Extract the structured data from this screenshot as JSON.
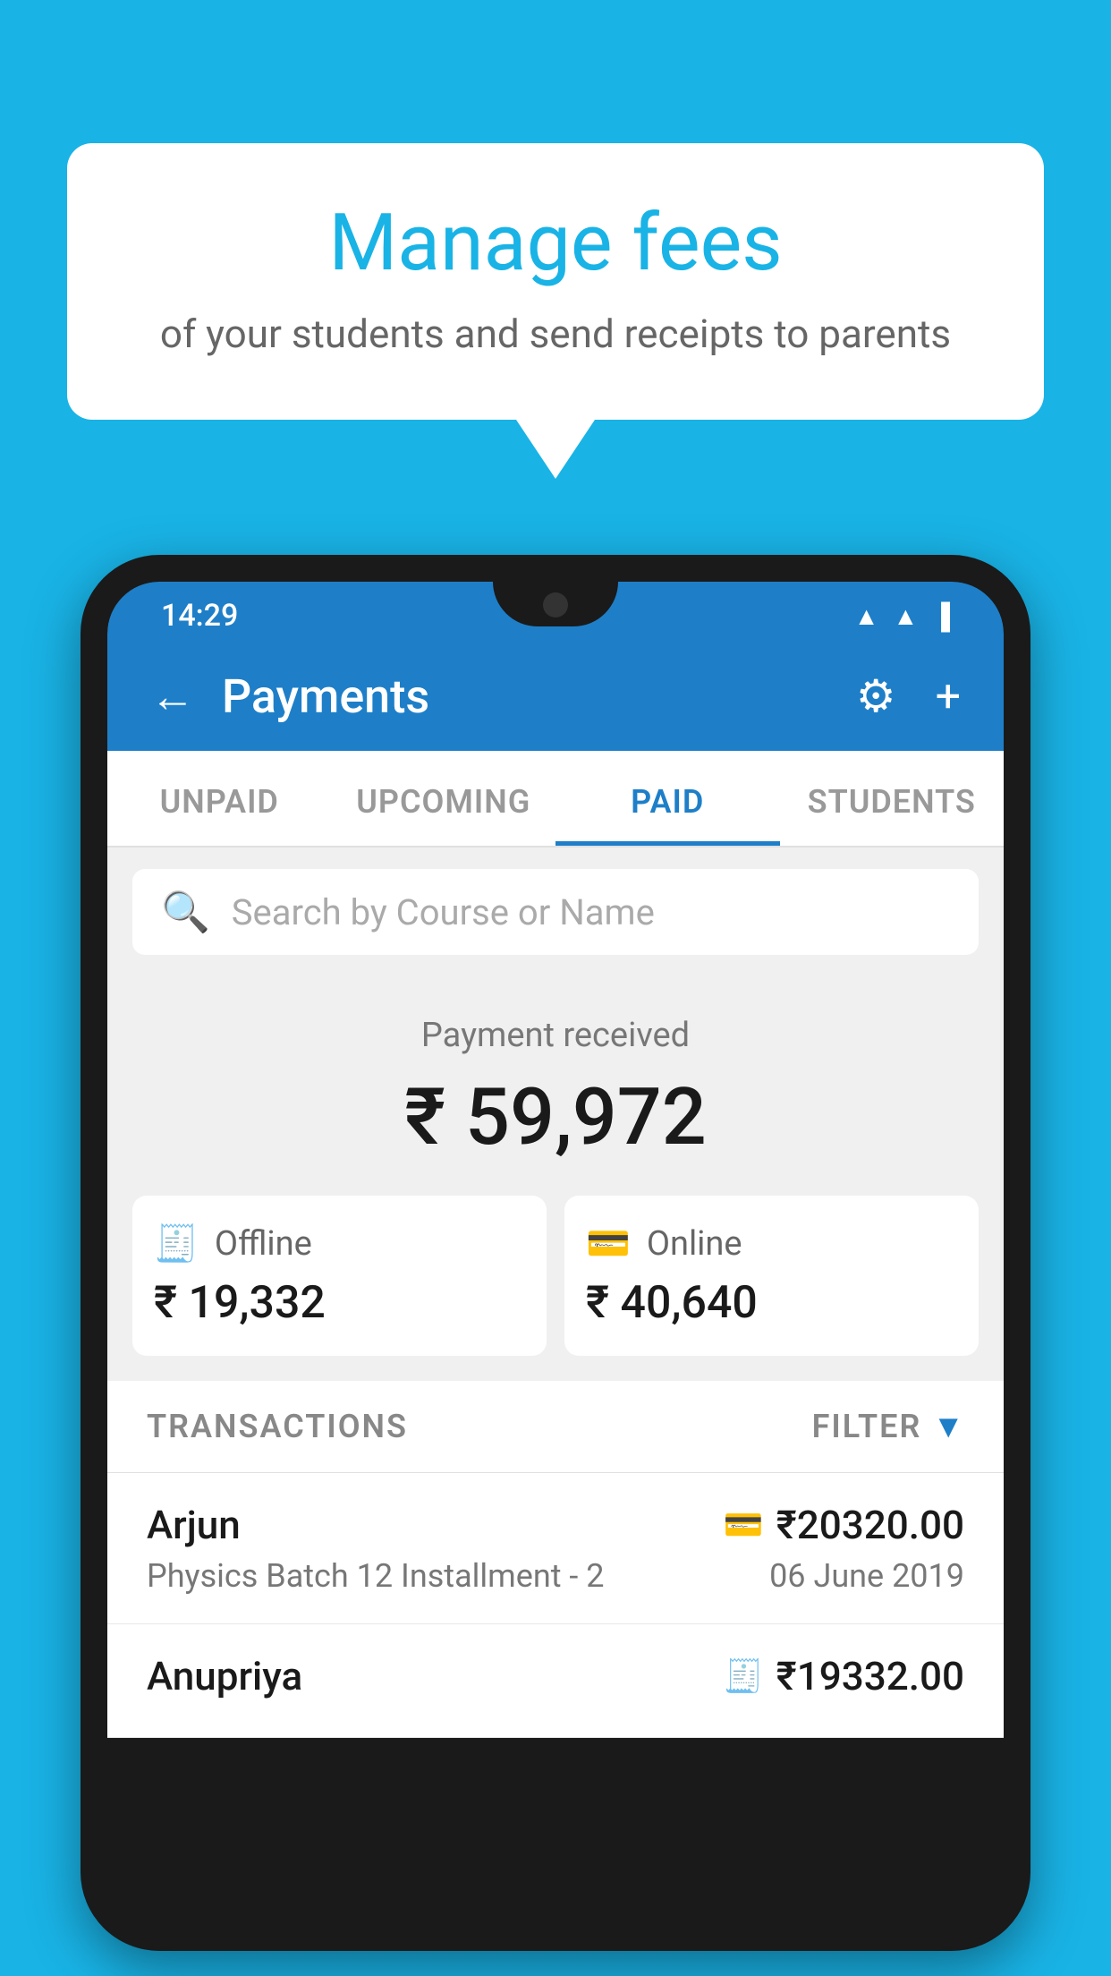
{
  "background_color": "#19b3e6",
  "speech_bubble": {
    "title": "Manage fees",
    "subtitle": "of your students and send receipts to parents"
  },
  "phone": {
    "status_bar": {
      "time": "14:29",
      "icons": [
        "wifi",
        "signal",
        "battery"
      ]
    },
    "header": {
      "title": "Payments",
      "back_label": "←",
      "settings_icon": "⚙",
      "add_icon": "+"
    },
    "tabs": [
      {
        "label": "UNPAID",
        "active": false
      },
      {
        "label": "UPCOMING",
        "active": false
      },
      {
        "label": "PAID",
        "active": true
      },
      {
        "label": "STUDENTS",
        "active": false
      }
    ],
    "search": {
      "placeholder": "Search by Course or Name"
    },
    "payment_summary": {
      "label": "Payment received",
      "total": "₹ 59,972",
      "offline": {
        "label": "Offline",
        "amount": "₹ 19,332"
      },
      "online": {
        "label": "Online",
        "amount": "₹ 40,640"
      }
    },
    "transactions": {
      "header_label": "TRANSACTIONS",
      "filter_label": "FILTER",
      "rows": [
        {
          "name": "Arjun",
          "amount": "₹20320.00",
          "course": "Physics Batch 12 Installment - 2",
          "date": "06 June 2019",
          "payment_type": "online"
        },
        {
          "name": "Anupriya",
          "amount": "₹19332.00",
          "course": "",
          "date": "",
          "payment_type": "offline"
        }
      ]
    }
  }
}
